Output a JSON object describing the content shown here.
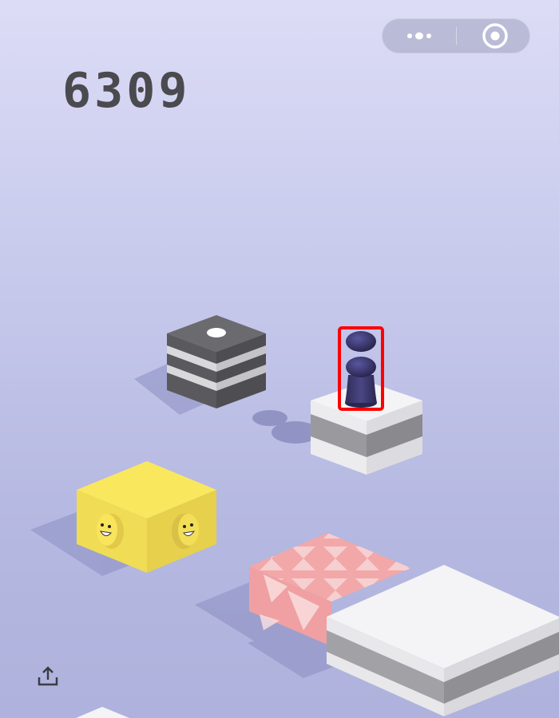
{
  "score": "6309",
  "capsule": {
    "more_icon": "more-dots-icon",
    "close_icon": "target-circle-icon"
  },
  "share_icon": "share-upload-icon",
  "highlight_color": "#ff0000"
}
